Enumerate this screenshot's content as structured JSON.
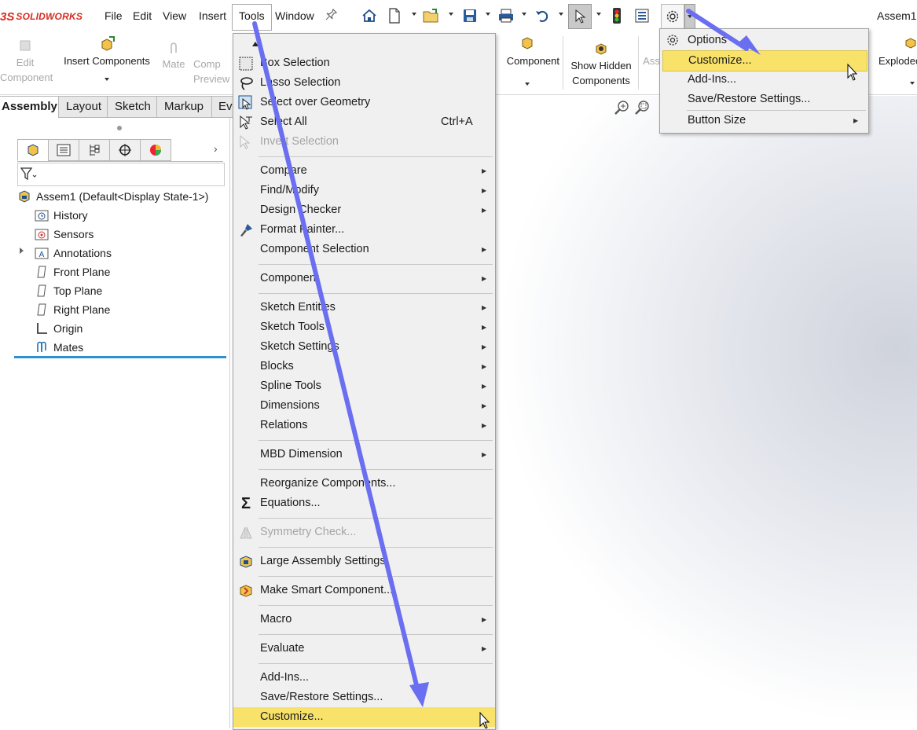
{
  "app": {
    "logo_ds": "3S",
    "logo_name": "SOLIDWORKS",
    "doc_title": "Assem1"
  },
  "menubar": {
    "items": [
      "File",
      "Edit",
      "View",
      "Insert",
      "Tools",
      "Window"
    ],
    "active": "Tools"
  },
  "ribbon": {
    "edit_component": [
      "Edit",
      "Component"
    ],
    "insert_components": "Insert Components",
    "mate": "Mate",
    "comp_preview": [
      "Comp",
      "Preview"
    ],
    "component": "Component",
    "show_hidden": [
      "Show Hidden",
      "Components"
    ],
    "ass": "Ass",
    "exploded": "Explodec"
  },
  "tabs": [
    "Assembly",
    "Layout",
    "Sketch",
    "Markup",
    "Ev"
  ],
  "feature_tree": {
    "root": "Assem1  (Default<Display State-1>)",
    "items": [
      "History",
      "Sensors",
      "Annotations",
      "Front Plane",
      "Top Plane",
      "Right Plane",
      "Origin",
      "Mates"
    ]
  },
  "tools_menu": {
    "items": [
      {
        "label": "Box Selection"
      },
      {
        "label": "Lasso Selection"
      },
      {
        "label": "Select over Geometry"
      },
      {
        "label": "Select All",
        "shortcut": "Ctrl+A"
      },
      {
        "label": "Invert Selection"
      },
      {
        "label": "Compare"
      },
      {
        "label": "Find/Modify"
      },
      {
        "label": "Design Checker"
      },
      {
        "label": "Format Painter..."
      },
      {
        "label": "Component Selection"
      },
      {
        "label": "Component"
      },
      {
        "label": "Sketch Entities"
      },
      {
        "label": "Sketch Tools"
      },
      {
        "label": "Sketch Settings"
      },
      {
        "label": "Blocks"
      },
      {
        "label": "Spline Tools"
      },
      {
        "label": "Dimensions"
      },
      {
        "label": "Relations"
      },
      {
        "label": "MBD Dimension"
      },
      {
        "label": "Reorganize Components..."
      },
      {
        "label": "Equations..."
      },
      {
        "label": "Symmetry Check..."
      },
      {
        "label": "Large Assembly Settings"
      },
      {
        "label": "Make Smart Component..."
      },
      {
        "label": "Macro"
      },
      {
        "label": "Evaluate"
      },
      {
        "label": "Add-Ins..."
      },
      {
        "label": "Save/Restore Settings..."
      },
      {
        "label": "Customize..."
      }
    ]
  },
  "options_menu": {
    "items": [
      "Options",
      "Customize...",
      "Add-Ins...",
      "Save/Restore Settings...",
      "Button Size"
    ]
  },
  "colors": {
    "highlight": "#f8e26a",
    "annotation_arrow": "#6a6ef0",
    "brand_red": "#d52b1e"
  }
}
